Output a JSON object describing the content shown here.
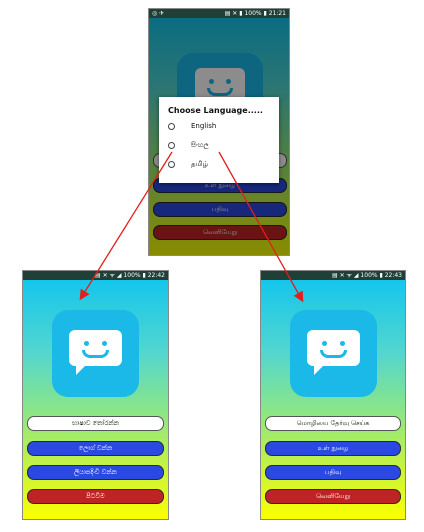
{
  "top_phone": {
    "status": {
      "left": "◎ ✈",
      "right": "▤ ✕ ▮ 100% ▮ 21:21"
    },
    "dialog": {
      "title": "Choose Language.....",
      "options": [
        "English",
        "සිංහල",
        "தமிழ்"
      ]
    },
    "buttons": [
      "",
      "உள் நுழை",
      "பதிவு",
      "வெளியேறு"
    ]
  },
  "left_phone": {
    "status": {
      "left": "",
      "right": "▤ ✕ ᯤ ◢ 100% ▮ 22:42"
    },
    "buttons": [
      "භාෂාව තෝරන්න",
      "ලොග් වන්න",
      "ලියාපදිංචි වන්න",
      "පිටවීම"
    ]
  },
  "right_phone": {
    "status": {
      "left": "",
      "right": "▤ ✕ ᯤ ◢ 100% ▮ 22:43"
    },
    "buttons": [
      "மொழியை தேர்வு செய்க",
      "உள் நுழை",
      "பதிவு",
      "வெளியேறு"
    ]
  },
  "icon": "chat-bubble-smile-icon",
  "colors": {
    "button_blue": "#2a48e2",
    "button_red": "#bf2424",
    "arrow_red": "#e0201a",
    "icon_blue": "#1ab9e8"
  }
}
